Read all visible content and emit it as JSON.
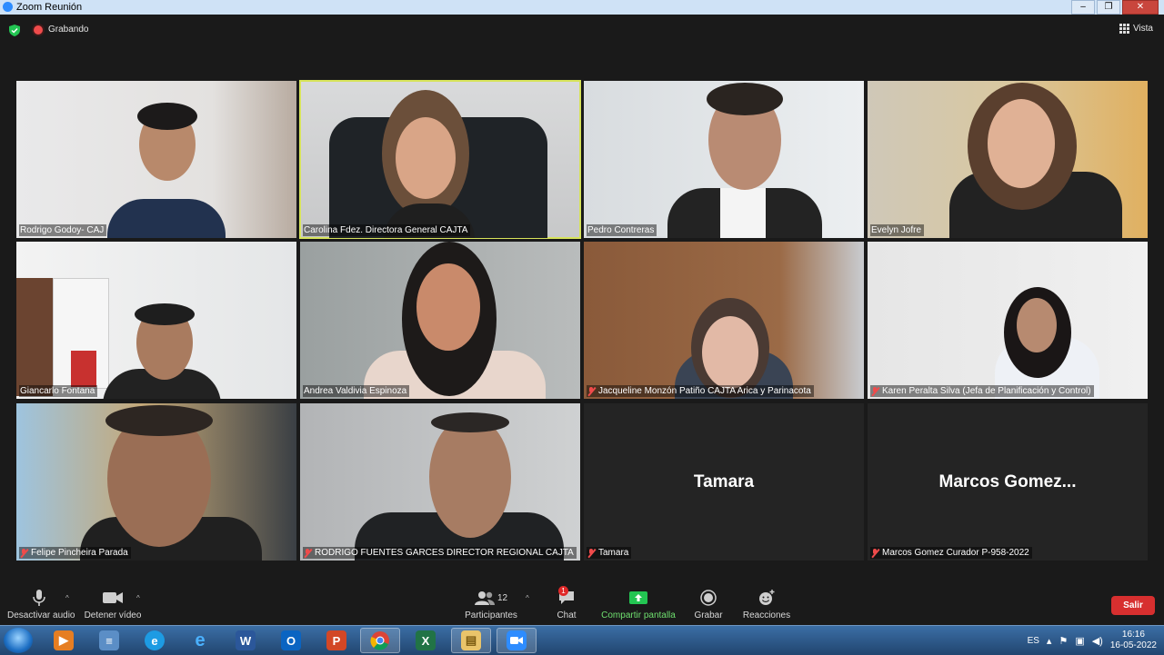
{
  "window": {
    "title": "Zoom Reunión",
    "controls": [
      "–",
      "❐",
      "✕"
    ]
  },
  "topbar": {
    "recording_label": "Grabando",
    "view_label": "Vista"
  },
  "tiles": [
    {
      "name": "Rodrigo Godoy- CAJ",
      "muted": false
    },
    {
      "name": "Carolina Fdez. Directora General CAJTA",
      "muted": false,
      "active": true
    },
    {
      "name": "Pedro Contreras",
      "muted": false
    },
    {
      "name": "Evelyn Jofre",
      "muted": false
    },
    {
      "name": "Giancarlo Fontana",
      "muted": false
    },
    {
      "name": "Andrea Valdivia Espinoza",
      "muted": false
    },
    {
      "name": "Jacqueline Monzón Patiño CAJTA Arica y Parinacota",
      "muted": true
    },
    {
      "name": "Karen Peralta Silva (Jefa de Planificación y Control)",
      "muted": true
    },
    {
      "name": "Felipe Pincheira Parada",
      "muted": true
    },
    {
      "name": "RODRIGO FUENTES GARCES DIRECTOR REGIONAL CAJTA",
      "muted": true
    },
    {
      "name": "Tamara",
      "muted": true,
      "display_name": "Tamara"
    },
    {
      "name": "Marcos Gomez Curador P-958-2022",
      "muted": true,
      "display_name": "Marcos  Gomez..."
    }
  ],
  "toolbar": {
    "mute_label": "Desactivar audio",
    "video_label": "Detener vídeo",
    "participants_label": "Participantes",
    "participants_count": "12",
    "chat_label": "Chat",
    "chat_badge": "1",
    "share_label": "Compartir pantalla",
    "record_label": "Grabar",
    "reactions_label": "Reacciones",
    "leave_label": "Salir"
  },
  "taskbar": {
    "apps": [
      "windows-media-player",
      "network-folder",
      "edge",
      "internet-explorer",
      "word",
      "outlook",
      "powerpoint",
      "chrome",
      "excel",
      "file-explorer",
      "zoom"
    ],
    "language": "ES",
    "time": "16:16",
    "date": "16-05-2022"
  },
  "colors": {
    "active_border": "#d7e35a",
    "leave": "#d72f2f",
    "share_green": "#6fe06f",
    "muted_red": "#ef4b4b"
  }
}
